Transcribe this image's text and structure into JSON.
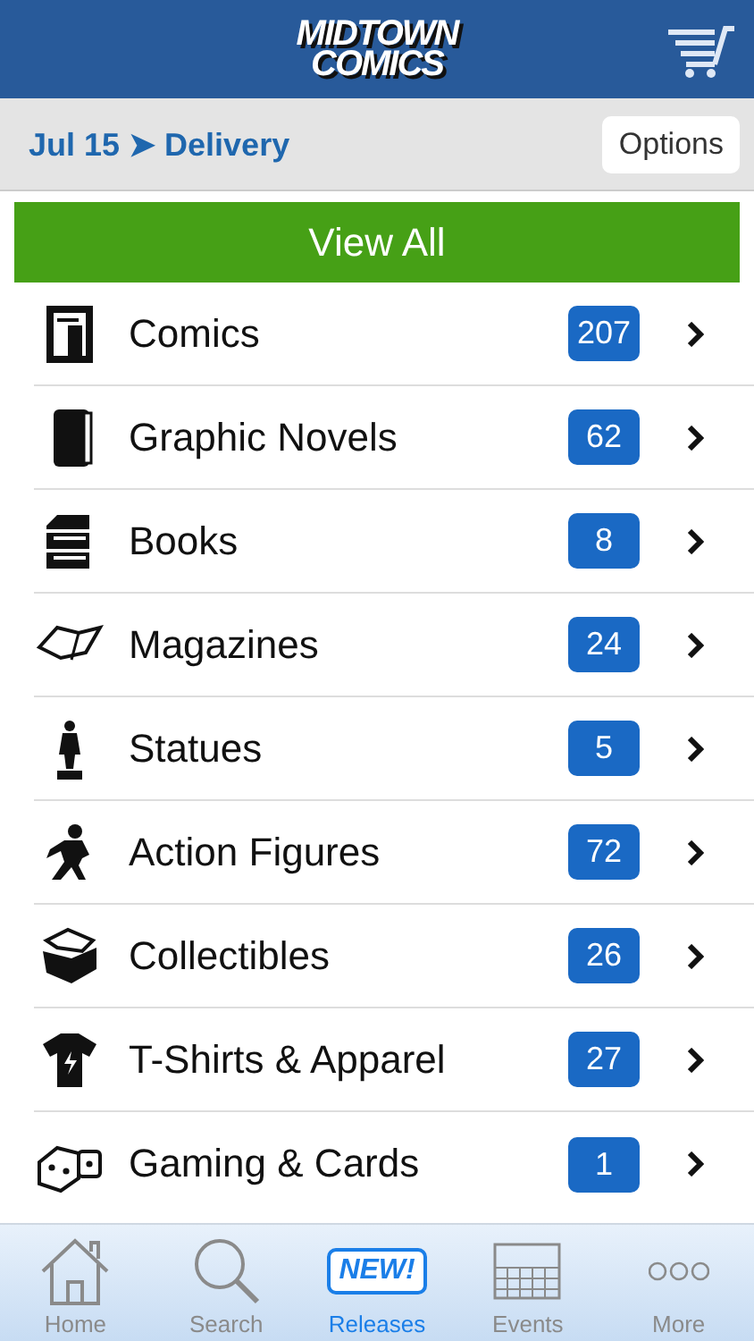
{
  "header": {
    "logo": [
      "MIDTOWN",
      "COMICS"
    ]
  },
  "subbar": {
    "date": "Jul 15",
    "arrow": "➤",
    "title": "Delivery",
    "options_button": "Options"
  },
  "view_all_button": "View All",
  "categories": [
    {
      "kind": "comic",
      "label": "Comics",
      "count": "207"
    },
    {
      "kind": "novel",
      "label": "Graphic Novels",
      "count": "62"
    },
    {
      "kind": "books",
      "label": "Books",
      "count": "8"
    },
    {
      "kind": "magazine",
      "label": "Magazines",
      "count": "24"
    },
    {
      "kind": "statue",
      "label": "Statues",
      "count": "5"
    },
    {
      "kind": "figure",
      "label": "Action Figures",
      "count": "72"
    },
    {
      "kind": "chest",
      "label": "Collectibles",
      "count": "26"
    },
    {
      "kind": "shirt",
      "label": "T-Shirts & Apparel",
      "count": "27"
    },
    {
      "kind": "dice",
      "label": "Gaming & Cards",
      "count": "1"
    }
  ],
  "tab_bar": [
    {
      "kind": "home",
      "label": "Home",
      "selected": false
    },
    {
      "kind": "search",
      "label": "Search",
      "selected": false
    },
    {
      "kind": "new",
      "label": "Releases",
      "badge": "NEW!",
      "selected": true
    },
    {
      "kind": "calendar",
      "label": "Events",
      "selected": false
    },
    {
      "kind": "more",
      "label": "More",
      "selected": false
    }
  ]
}
